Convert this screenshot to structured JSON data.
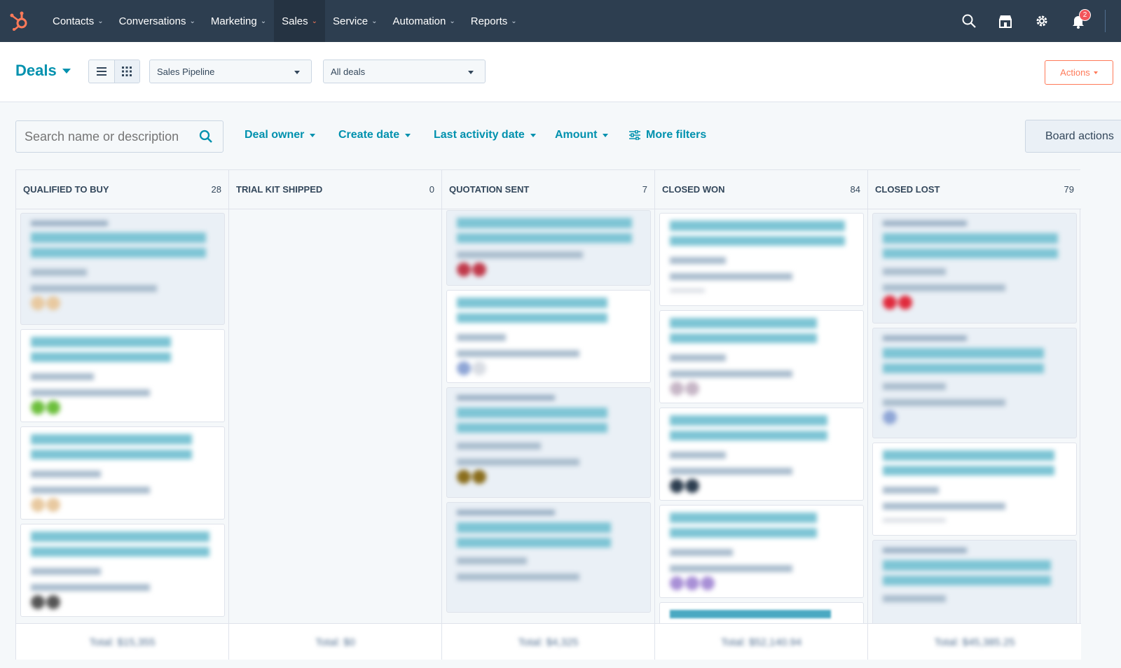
{
  "nav": {
    "items": [
      {
        "label": "Contacts"
      },
      {
        "label": "Conversations"
      },
      {
        "label": "Marketing"
      },
      {
        "label": "Sales"
      },
      {
        "label": "Service"
      },
      {
        "label": "Automation"
      },
      {
        "label": "Reports"
      }
    ],
    "active": "Sales",
    "notifications_count": "2"
  },
  "header": {
    "title": "Deals",
    "pipeline": "Sales Pipeline",
    "view": "All deals",
    "actions_label": "Actions"
  },
  "filters": {
    "search_placeholder": "Search name or description",
    "deal_owner": "Deal owner",
    "create_date": "Create date",
    "last_activity_date": "Last activity date",
    "amount": "Amount",
    "more_filters": "More filters",
    "board_actions": "Board actions"
  },
  "columns": [
    {
      "name": "QUALIFIED TO BUY",
      "count": "28",
      "total": "Total: $15,355"
    },
    {
      "name": "TRIAL KIT SHIPPED",
      "count": "0",
      "total": "Total: $0"
    },
    {
      "name": "QUOTATION SENT",
      "count": "7",
      "total": "Total: $4,325"
    },
    {
      "name": "CLOSED WON",
      "count": "84",
      "total": "Total: $52,140.94"
    },
    {
      "name": "CLOSED LOST",
      "count": "79",
      "total": "Total: $45,385.25"
    }
  ],
  "colors": {
    "nav_bg": "#2d3e50",
    "accent": "#0091ae",
    "orange": "#ff7a59"
  }
}
